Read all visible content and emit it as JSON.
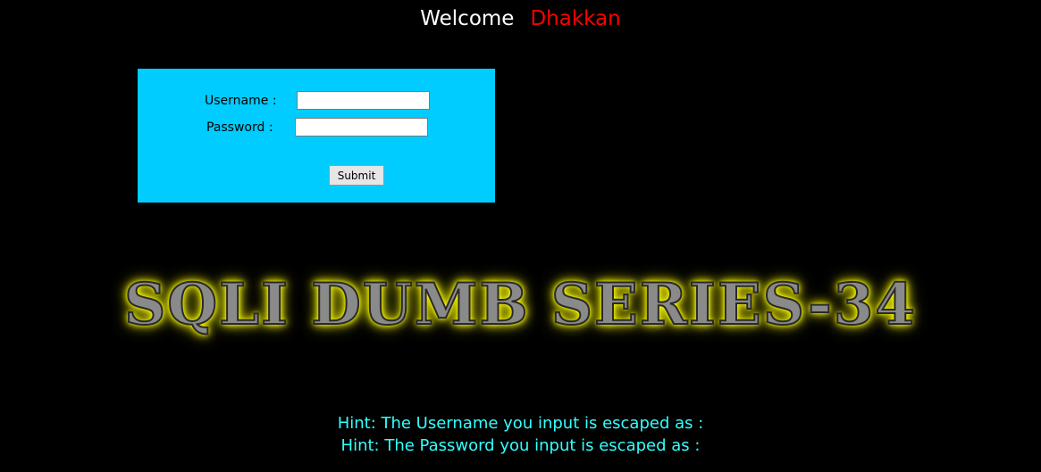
{
  "header": {
    "welcome_text": "Welcome",
    "user_name": "Dhakkan"
  },
  "login_form": {
    "username_label": "Username :",
    "password_label": "Password :",
    "username_value": "",
    "password_value": "",
    "submit_label": "Submit"
  },
  "banner": {
    "title": "SQLI DUMB SERIES-34"
  },
  "hints": {
    "username_hint": "Hint: The Username you input is escaped as :",
    "password_hint": "Hint: The Password you input is escaped as :"
  },
  "colors": {
    "background": "#000000",
    "form_background": "#00ccff",
    "welcome_user": "#ff0000",
    "hint_text": "#33ffff",
    "banner_glow": "#ffff00"
  }
}
